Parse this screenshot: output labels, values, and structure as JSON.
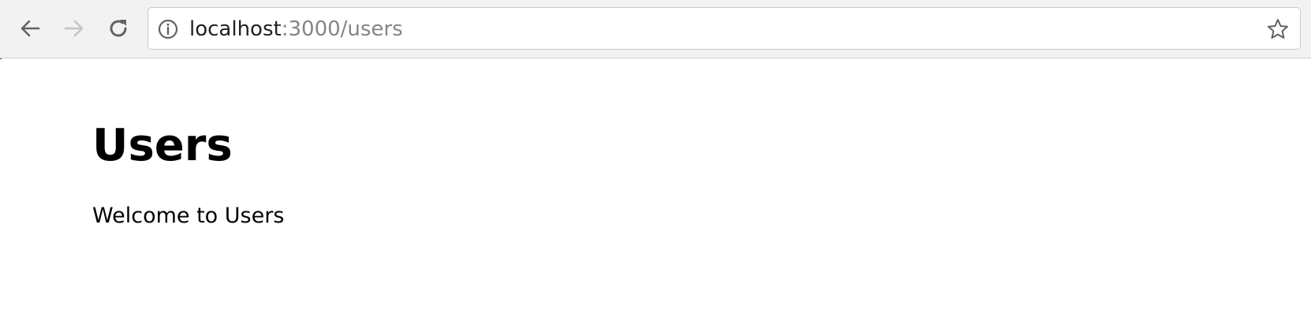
{
  "browser": {
    "url_host": "localhost",
    "url_path": ":3000/users",
    "icons": {
      "back": "arrow-left-icon",
      "forward": "arrow-right-icon",
      "reload": "reload-icon",
      "info": "info-icon",
      "bookmark": "star-icon"
    },
    "forward_enabled": false,
    "colors": {
      "toolbar_bg": "#f2f2f2",
      "icon_active": "#5f6368",
      "icon_disabled": "#c4c4c4",
      "url_host": "#202124",
      "url_path": "#80868b"
    }
  },
  "page": {
    "title": "Users",
    "subtitle": "Welcome to Users"
  }
}
